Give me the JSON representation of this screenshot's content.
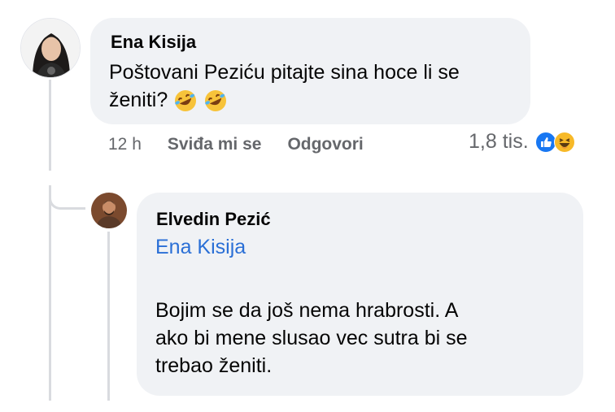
{
  "comment": {
    "author": "Ena Kisija",
    "text_line1": "Poštovani Peziću pitajte sina hoce li se",
    "text_line2": "ženiti?",
    "time": "12 h",
    "like_label": "Sviđa mi se",
    "reply_label": "Odgovori",
    "reaction_count": "1,8 tis.",
    "reaction_icons": [
      "like-icon",
      "haha-icon"
    ],
    "inline_emojis": [
      "rofl-emoji",
      "rofl-emoji"
    ]
  },
  "reply": {
    "author": "Elvedin Pezić",
    "mention": "Ena Kisija",
    "text_line1": "Bojim se da još nema hrabrosti. A",
    "text_line2": "ako bi mene slusao vec sutra bi se",
    "text_line3": "trebao ženiti."
  },
  "colors": {
    "bubble_bg": "#f0f2f5",
    "mention": "#2a6fd6",
    "meta_text": "#65676b",
    "like_blue": "#1877f2",
    "haha_yellow": "#f7b928"
  }
}
